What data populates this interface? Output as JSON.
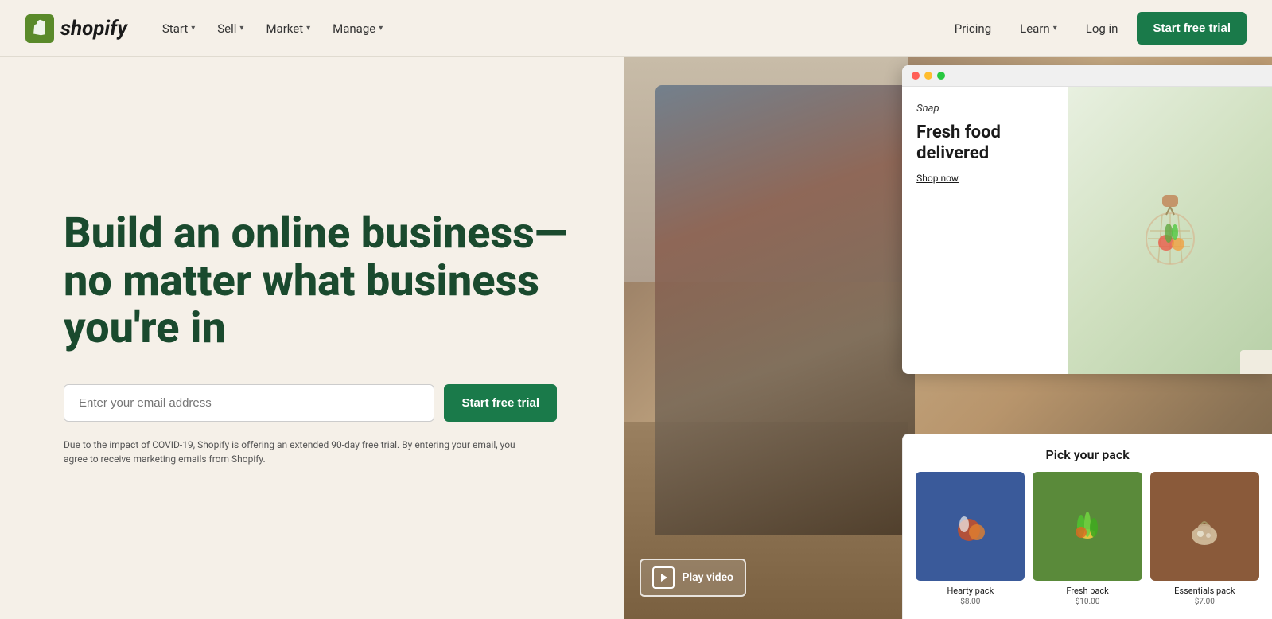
{
  "nav": {
    "logo_text": "shopify",
    "links_left": [
      {
        "label": "Start",
        "has_dropdown": true
      },
      {
        "label": "Sell",
        "has_dropdown": true
      },
      {
        "label": "Market",
        "has_dropdown": true
      },
      {
        "label": "Manage",
        "has_dropdown": true
      }
    ],
    "pricing_label": "Pricing",
    "learn_label": "Learn",
    "login_label": "Log in",
    "cta_label": "Start free trial"
  },
  "hero": {
    "headline": "Build an online business—no matter what business you're in",
    "email_placeholder": "Enter your email address",
    "cta_label": "Start free trial",
    "disclaimer": "Due to the impact of COVID-19, Shopify is offering an extended 90-day free trial. By entering your email, you agree to receive marketing emails from Shopify."
  },
  "store_preview": {
    "window_dots": [
      "#ff5f57",
      "#ffbd2e",
      "#28c840"
    ],
    "brand": "Snap",
    "headline": "Fresh food delivered",
    "shop_link": "Shop now",
    "product_grid_title": "Pick your pack",
    "products": [
      {
        "name": "Hearty pack",
        "price": "$8.00",
        "bg": "#3a5a9a"
      },
      {
        "name": "Fresh pack",
        "price": "$10.00",
        "bg": "#5a8a3a"
      },
      {
        "name": "Essentials pack",
        "price": "$7.00",
        "bg": "#8a5a3a"
      }
    ]
  },
  "video_button": {
    "label": "Play video"
  }
}
